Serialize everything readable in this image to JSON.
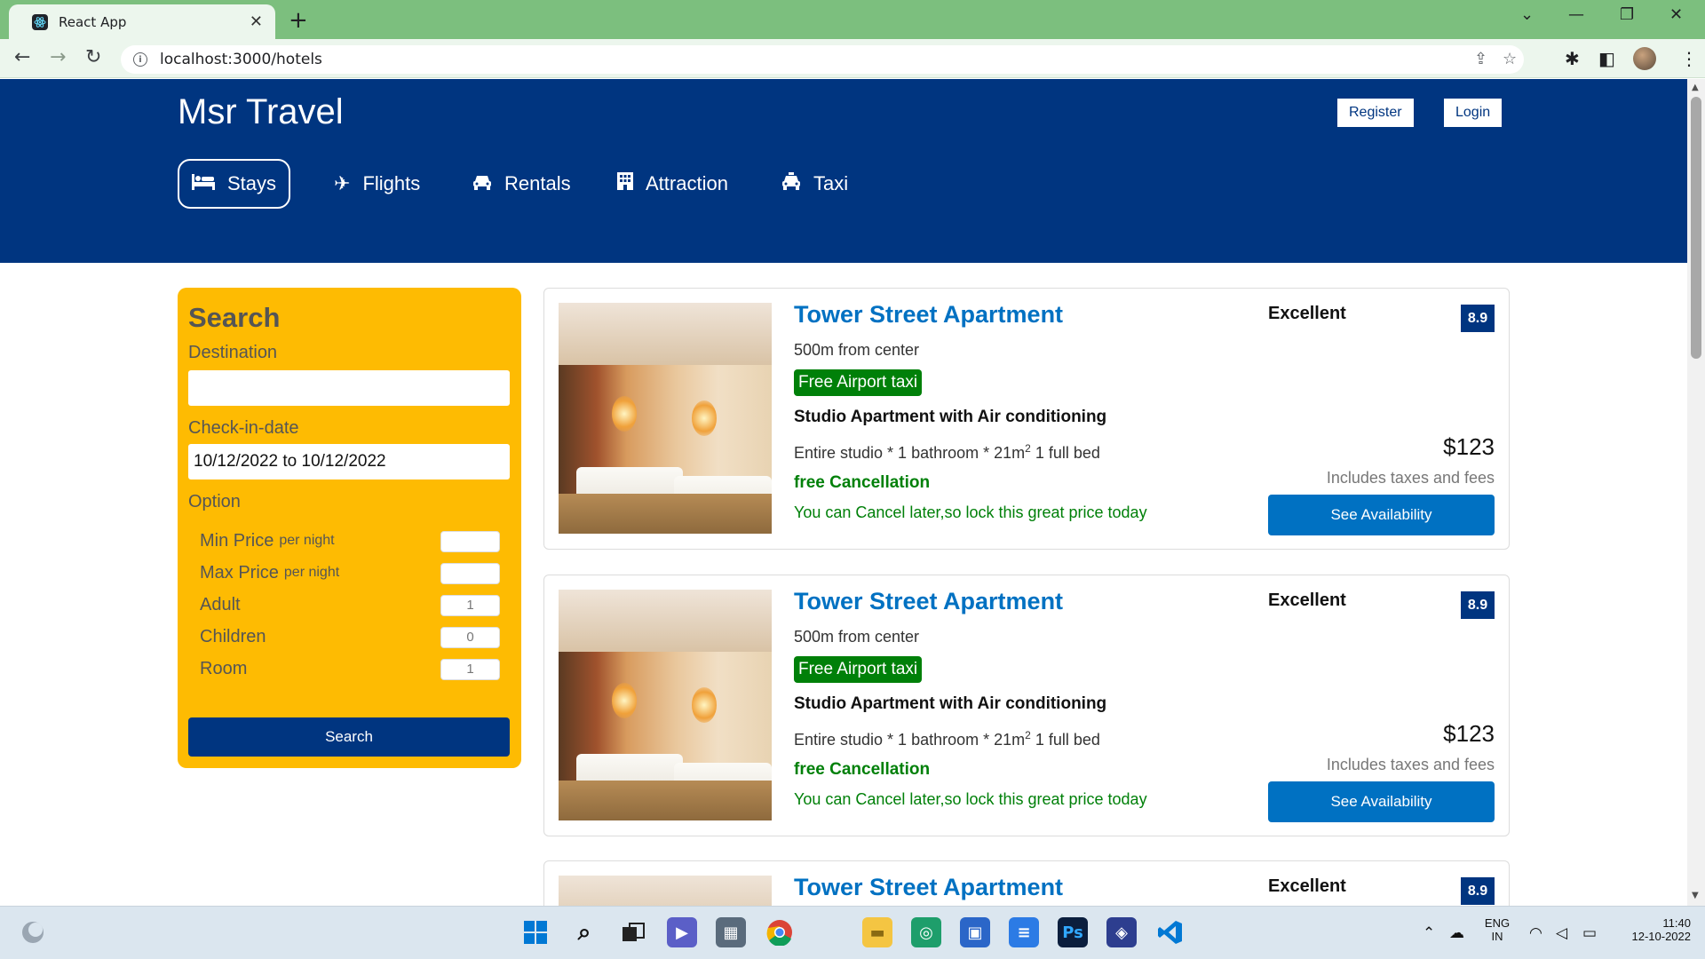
{
  "browser": {
    "tab_title": "React App",
    "url": "localhost:3000/hotels"
  },
  "header": {
    "logo": "Msr Travel",
    "register_label": "Register",
    "login_label": "Login",
    "nav": [
      {
        "label": "Stays",
        "icon": "bed-icon",
        "active": true
      },
      {
        "label": "Flights",
        "icon": "plane-icon"
      },
      {
        "label": "Rentals",
        "icon": "car-icon"
      },
      {
        "label": "Attraction",
        "icon": "building-icon"
      },
      {
        "label": "Taxi",
        "icon": "taxi-icon"
      }
    ]
  },
  "search": {
    "title": "Search",
    "destination_label": "Destination",
    "destination_value": "",
    "checkin_label": "Check-in-date",
    "checkin_value": "10/12/2022 to 10/12/2022",
    "option_label": "Option",
    "options": [
      {
        "label": "Min Price",
        "sub": "per night",
        "value": ""
      },
      {
        "label": "Max Price",
        "sub": "per night",
        "value": ""
      },
      {
        "label": "Adult",
        "sub": "",
        "value": "1"
      },
      {
        "label": "Children",
        "sub": "",
        "value": "0"
      },
      {
        "label": "Room",
        "sub": "",
        "value": "1"
      }
    ],
    "button_label": "Search"
  },
  "results": [
    {
      "title": "Tower Street Apartment",
      "distance": "500m from center",
      "taxi_badge": "Free Airport taxi",
      "subtitle": "Studio Apartment with Air conditioning",
      "features_a": "Entire studio * 1 bathroom * 21m",
      "features_sup": "2",
      "features_b": "1 full bed",
      "cancel": "free Cancellation",
      "cancel_sub": "You can Cancel later,so lock this great price today",
      "rating_text": "Excellent",
      "score": "8.9",
      "price": "$123",
      "tax": "Includes taxes and fees",
      "button": "See Availability"
    },
    {
      "title": "Tower Street Apartment",
      "distance": "500m from center",
      "taxi_badge": "Free Airport taxi",
      "subtitle": "Studio Apartment with Air conditioning",
      "features_a": "Entire studio * 1 bathroom * 21m",
      "features_sup": "2",
      "features_b": "1 full bed",
      "cancel": "free Cancellation",
      "cancel_sub": "You can Cancel later,so lock this great price today",
      "rating_text": "Excellent",
      "score": "8.9",
      "price": "$123",
      "tax": "Includes taxes and fees",
      "button": "See Availability"
    },
    {
      "title": "Tower Street Apartment",
      "rating_text": "Excellent",
      "score": "8.9"
    }
  ],
  "taskbar": {
    "lang_top": "ENG",
    "lang_bottom": "IN",
    "time": "11:40",
    "date": "12-10-2022"
  },
  "colors": {
    "brand": "#003580",
    "accent": "#0071c2",
    "sidebar": "#febb02",
    "green": "#008009",
    "browser_frame": "#7cbf7e"
  }
}
